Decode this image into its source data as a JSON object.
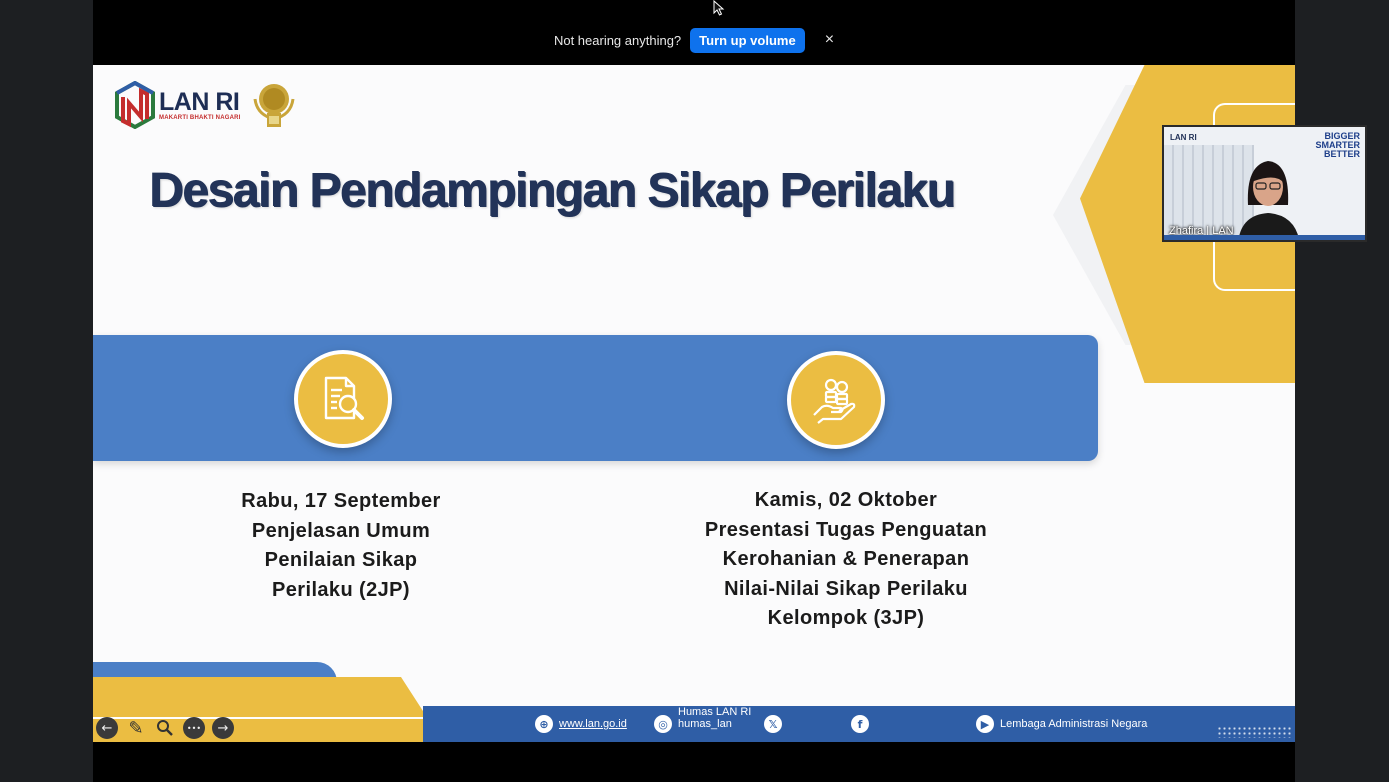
{
  "notification": {
    "message": "Not hearing anything?",
    "action_label": "Turn up volume",
    "close_label": "×"
  },
  "slide": {
    "logo_name": "LAN RI",
    "logo_tagline": "MAKARTI BHAKTI NAGARI",
    "title": "Desain Pendampingan Sikap Perilaku",
    "sessions": [
      {
        "icon": "document-search-icon",
        "lines": [
          "Rabu, 17 September",
          "Penjelasan Umum",
          "Penilaian Sikap",
          "Perilaku (2JP)"
        ]
      },
      {
        "icon": "hand-coins-icon",
        "lines": [
          "Kamis, 02 Oktober",
          "Presentasi Tugas Penguatan",
          "Kerohanian & Penerapan",
          "Nilai-Nilai Sikap Perilaku",
          "Kelompok (3JP)"
        ]
      }
    ],
    "footer": {
      "website": "www.lan.go.id",
      "instagram_line1": "Humas LAN RI",
      "instagram_line2": "humas_lan",
      "youtube": "Lembaga Administrasi Negara"
    },
    "colors": {
      "gold": "#ebbd42",
      "blue": "#4b7fc6",
      "navy": "#223358"
    }
  },
  "toolbar": {
    "prev": "←",
    "pen": "✎",
    "zoom": "🔍",
    "more": "•••",
    "next": "→"
  },
  "participant": {
    "name": "Zhafira | LAN",
    "bg_logo": "LAN RI",
    "slogan": [
      "BIGGER",
      "SMARTER",
      "BETTER"
    ]
  }
}
